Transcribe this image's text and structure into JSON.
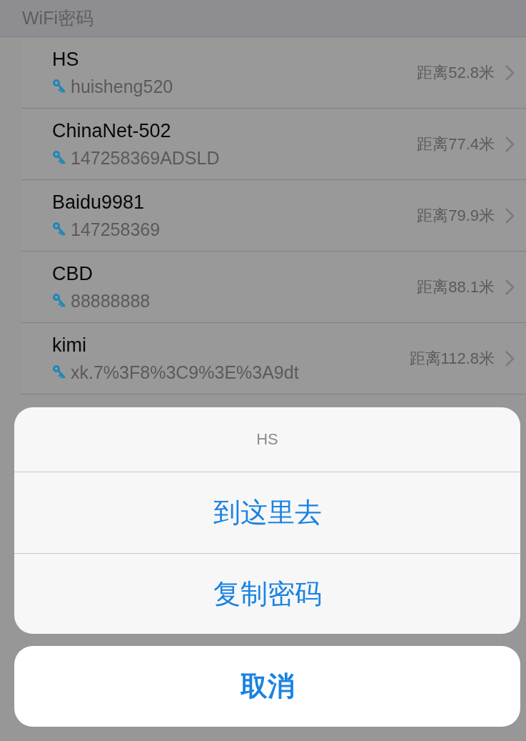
{
  "section_header": "WiFi密码",
  "networks": [
    {
      "name": "HS",
      "password": "huisheng520",
      "distance": "距离52.8米"
    },
    {
      "name": "ChinaNet-502",
      "password": "147258369ADSLD",
      "distance": "距离77.4米"
    },
    {
      "name": "Baidu9981",
      "password": "147258369",
      "distance": "距离79.9米"
    },
    {
      "name": "CBD",
      "password": "88888888",
      "distance": "距离88.1米"
    },
    {
      "name": "kimi",
      "password": "xk.7%3F8%3C9%3E%3A9dt",
      "distance": "距离112.8米"
    }
  ],
  "action_sheet": {
    "title": "HS",
    "actions": [
      "到这里去",
      "复制密码"
    ],
    "cancel": "取消"
  }
}
